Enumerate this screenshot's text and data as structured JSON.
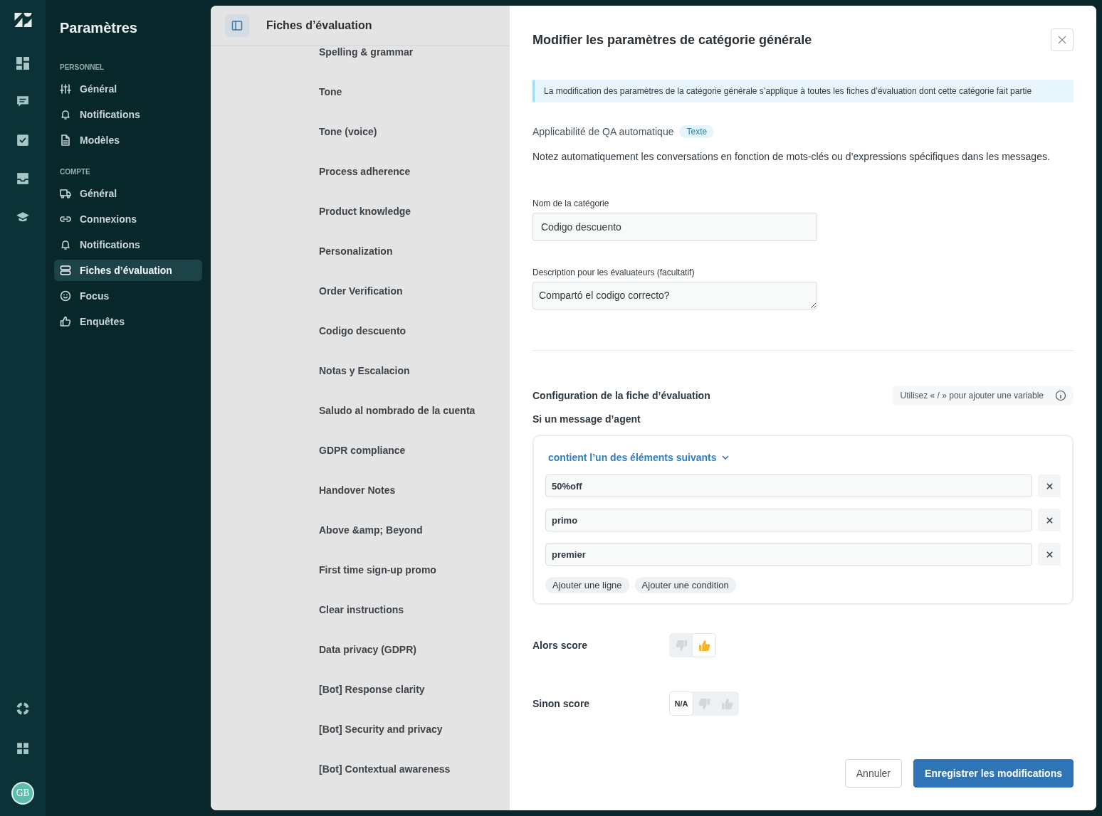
{
  "rail": {
    "avatar": "GB"
  },
  "nav": {
    "title": "Paramètres",
    "sections": [
      {
        "heading": "PERSONNEL",
        "items": [
          {
            "label": "Général",
            "selected": false
          },
          {
            "label": "Notifications",
            "selected": false
          },
          {
            "label": "Modèles",
            "selected": false
          }
        ]
      },
      {
        "heading": "COMPTE",
        "items": [
          {
            "label": "Général",
            "selected": false
          },
          {
            "label": "Connexions",
            "selected": false
          },
          {
            "label": "Notifications",
            "selected": false
          },
          {
            "label": "Fiches d’évaluation",
            "selected": true
          },
          {
            "label": "Focus",
            "selected": false
          },
          {
            "label": "Enquêtes",
            "selected": false
          }
        ]
      }
    ]
  },
  "list": {
    "title": "Fiches d’évaluation",
    "items": [
      "Spelling & grammar",
      "Tone",
      "Tone (voice)",
      "Process adherence",
      "Product knowledge",
      "Personalization",
      "Order Verification",
      "Codigo descuento",
      "Notas y Escalacion",
      "Saludo al nombrado de la cuenta",
      "GDPR compliance",
      "Handover Notes",
      "Above &amp; Beyond",
      "First time sign-up promo",
      "Clear instructions",
      "Data privacy (GDPR)",
      "[Bot] Response clarity",
      "[Bot] Security and privacy",
      "[Bot] Contextual awareness"
    ]
  },
  "drawer": {
    "title": "Modifier les paramètres de catégorie générale",
    "banner": "La modification des paramètres de la catégorie générale s’applique à toutes les fiches d’évaluation dont cette catégorie fait partie",
    "applicability": {
      "label": "Applicabilité de QA automatique",
      "tag": "Texte"
    },
    "description": "Notez automatiquement les conversations en fonction de mots-clés ou d’expressions spécifiques dans les messages.",
    "fields": [
      {
        "kind": "input",
        "label": "Nom de la catégorie",
        "value": "Codigo descuento"
      },
      {
        "kind": "textarea",
        "label": "Description pour les évaluateurs (facultatif)",
        "value": "Compartó el codigo correcto?"
      }
    ],
    "config": {
      "title": "Configuration de la fiche d’évaluation",
      "hint": "Utilisez « / » pour ajouter une variable",
      "condition_label": "Si un message d’agent",
      "operator": "contient l’un des éléments suivants",
      "keywords": [
        "50%off",
        "primo",
        "premier"
      ],
      "add_buttons": [
        "Ajouter une ligne",
        "Ajouter une condition"
      ]
    },
    "scores": [
      {
        "label": "Alors score",
        "options": [
          {
            "kind": "down",
            "selected": false
          },
          {
            "kind": "up",
            "selected": true
          }
        ]
      },
      {
        "label": "Sinon score",
        "options": [
          {
            "kind": "na",
            "label": "N/A",
            "selected": true
          },
          {
            "kind": "down",
            "selected": false
          },
          {
            "kind": "up",
            "selected": false
          }
        ]
      }
    ],
    "buttons": [
      {
        "kind": "secondary",
        "label": "Annuler"
      },
      {
        "kind": "primary",
        "label": "Enregistrer les modifications"
      }
    ]
  }
}
